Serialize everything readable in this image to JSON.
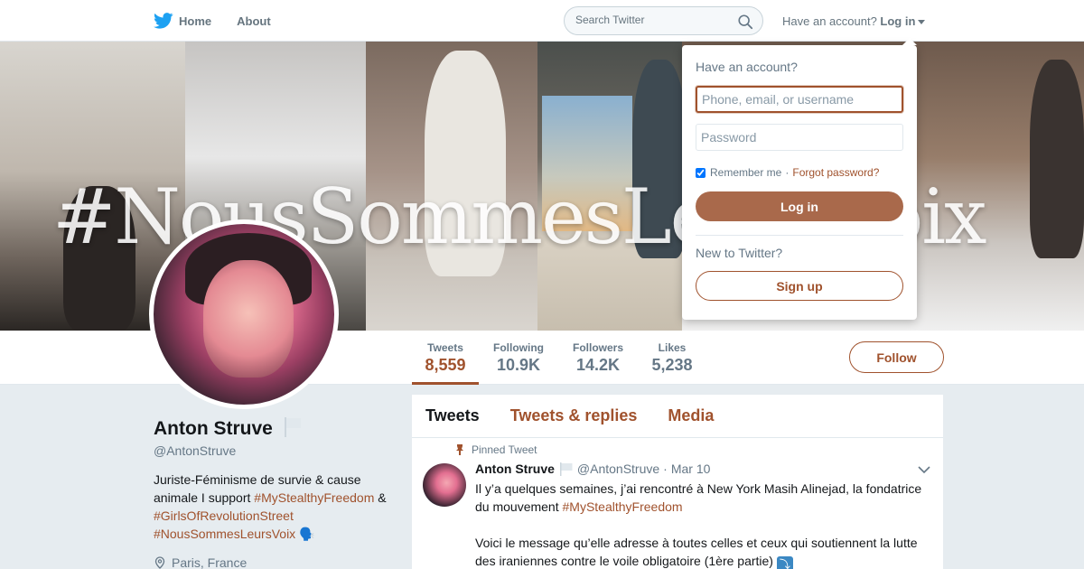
{
  "nav": {
    "home_label": "Home",
    "about_label": "About",
    "search_placeholder": "Search Twitter",
    "account_prompt": "Have an account?",
    "login_label": "Log in"
  },
  "banner": {
    "overlay_text": "#NousSommesLeursVoix"
  },
  "profile": {
    "name": "Anton Struve",
    "handle": "@AntonStruve",
    "bio_text_1": "Juriste-Féminisme de survie & cause animale I support ",
    "bio_tag_1": "#MyStealthyFreedom",
    "bio_text_2": " & ",
    "bio_tag_2": "#GirlsOfRevolutionStreet",
    "bio_tag_3": "#NousSommesLeursVoix",
    "bio_emoji": "🗣️",
    "location": "Paris, France"
  },
  "stats": [
    {
      "label": "Tweets",
      "value": "8,559"
    },
    {
      "label": "Following",
      "value": "10.9K"
    },
    {
      "label": "Followers",
      "value": "14.2K"
    },
    {
      "label": "Likes",
      "value": "5,238"
    }
  ],
  "follow_label": "Follow",
  "timeline": {
    "tabs": [
      "Tweets",
      "Tweets & replies",
      "Media"
    ],
    "tweet": {
      "pinned_label": "Pinned Tweet",
      "author_name": "Anton Struve",
      "author_handle": "@AntonStruve",
      "separator": "·",
      "date": "Mar 10",
      "text_1": "Il y’a quelques semaines, j’ai rencontré à New York Masih Alinejad, la fondatrice du mouvement ",
      "text_tag": "#MyStealthyFreedom",
      "text_2": "Voici le message qu’elle adresse à toutes celles et ceux qui soutiennent la lutte des iraniennes contre le voile obligatoire (1ère partie) ",
      "text_emoji": "⤵"
    }
  },
  "login_dropdown": {
    "title": "Have an account?",
    "username_placeholder": "Phone, email, or username",
    "password_placeholder": "Password",
    "remember_label": "Remember me",
    "separator": "·",
    "forgot_label": "Forgot password?",
    "login_button": "Log in",
    "new_prompt": "New to Twitter?",
    "signup_button": "Sign up"
  },
  "colors": {
    "accent": "#a0522d",
    "twitter_blue": "#1da1f2",
    "login_button_bg": "#a9694b"
  }
}
